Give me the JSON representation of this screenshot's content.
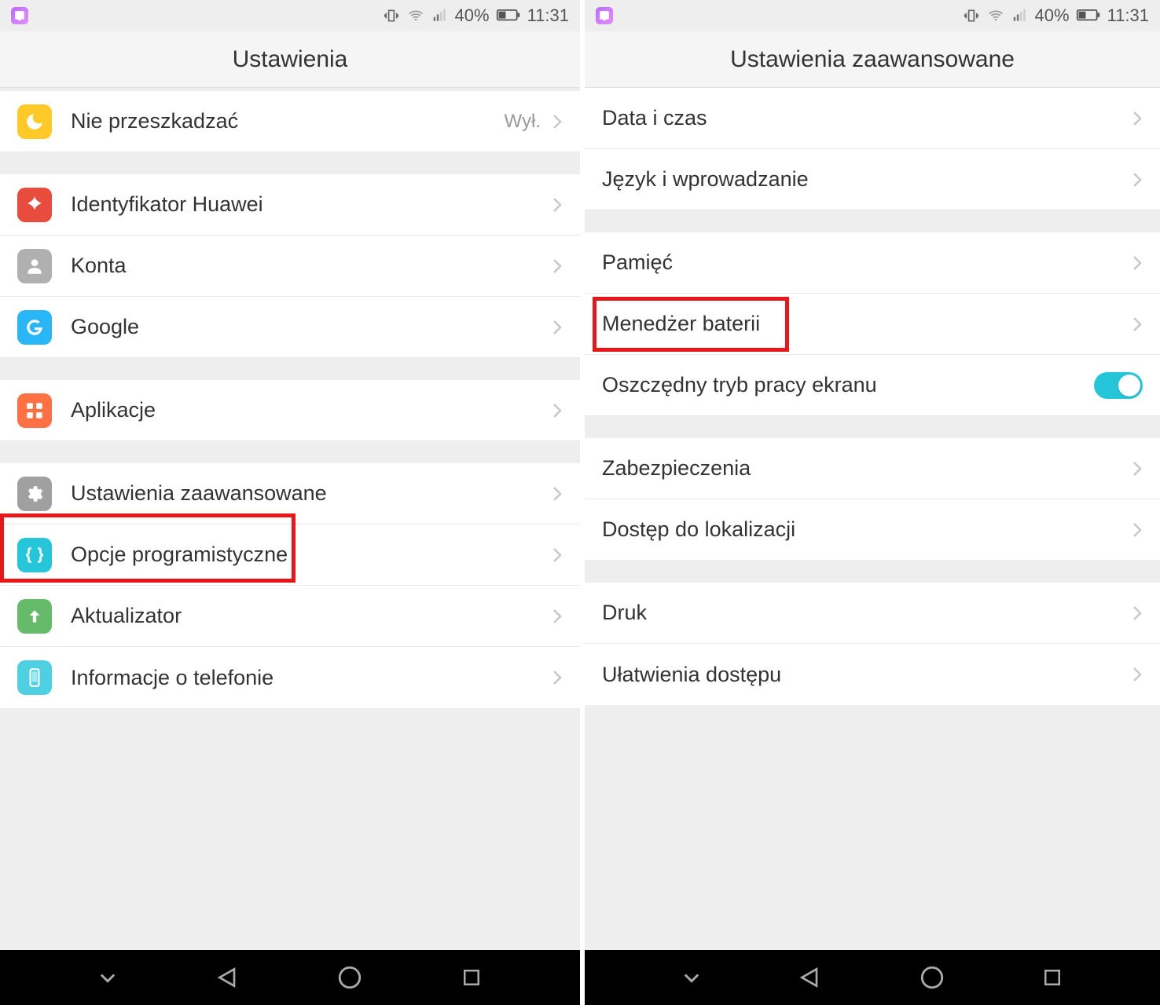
{
  "status": {
    "battery_text": "40%",
    "time": "11:31"
  },
  "left": {
    "title": "Ustawienia",
    "rows": {
      "dnd_label": "Nie przeszkadzać",
      "dnd_value": "Wył.",
      "huawei_id": "Identyfikator Huawei",
      "accounts": "Konta",
      "google": "Google",
      "apps": "Aplikacje",
      "advanced": "Ustawienia zaawansowane",
      "dev_options": "Opcje programistyczne",
      "updater": "Aktualizator",
      "about": "Informacje o telefonie"
    }
  },
  "right": {
    "title": "Ustawienia zaawansowane",
    "rows": {
      "date_time": "Data i czas",
      "language": "Język i wprowadzanie",
      "memory": "Pamięć",
      "battery_mgr": "Menedżer baterii",
      "eco_screen": "Oszczędny tryb pracy ekranu",
      "security": "Zabezpieczenia",
      "location": "Dostęp do lokalizacji",
      "print": "Druk",
      "accessibility": "Ułatwienia dostępu"
    }
  }
}
